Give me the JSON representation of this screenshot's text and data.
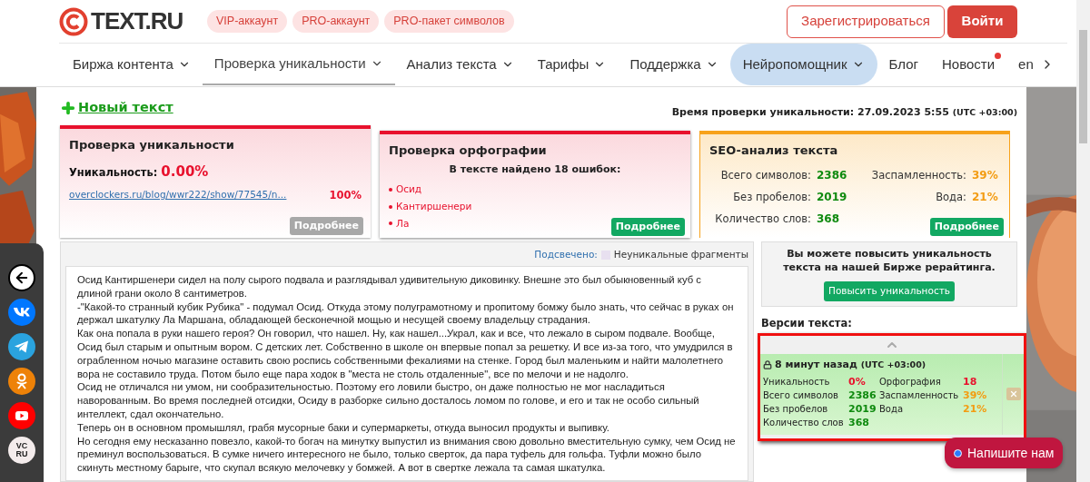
{
  "logo": {
    "text": "TEXT.RU"
  },
  "header_badges": [
    "VIP-аккаунт",
    "PRO-аккаунт",
    "PRO-пакет символов"
  ],
  "auth": {
    "register": "Зарегистрироваться",
    "login": "Войти"
  },
  "nav": [
    {
      "label": "Биржа контента",
      "dropdown": true,
      "selected": false,
      "highlighted": false,
      "notification": false
    },
    {
      "label": "Проверка уникальности",
      "dropdown": true,
      "selected": true,
      "highlighted": false,
      "notification": false
    },
    {
      "label": "Анализ текста",
      "dropdown": true,
      "selected": false,
      "highlighted": false,
      "notification": false
    },
    {
      "label": "Тарифы",
      "dropdown": true,
      "selected": false,
      "highlighted": false,
      "notification": false
    },
    {
      "label": "Поддержка",
      "dropdown": true,
      "selected": false,
      "highlighted": false,
      "notification": false
    },
    {
      "label": "Нейропомощник",
      "dropdown": true,
      "selected": false,
      "highlighted": true,
      "notification": false
    },
    {
      "label": "Блог",
      "dropdown": false,
      "selected": false,
      "highlighted": false,
      "notification": false
    },
    {
      "label": "Новости",
      "dropdown": false,
      "selected": false,
      "highlighted": false,
      "notification": true
    },
    {
      "label": "en",
      "dropdown": false,
      "selected": false,
      "highlighted": false,
      "notification": false
    }
  ],
  "new_text_link": "Новый текст",
  "check_time": {
    "label": "Время проверки уникальности:",
    "value": "27.09.2023 5:55",
    "timezone": "(UTC +03:00)"
  },
  "uniqueness_card": {
    "title": "Проверка уникальности",
    "label": "Уникальность:",
    "value": "0.00%",
    "sources": [
      {
        "url": "overclockers.ru/blog/wwr222/show/77545/n...",
        "percent": "100%"
      }
    ],
    "button": {
      "label": "Подробнее",
      "disabled": true
    }
  },
  "spelling_card": {
    "title": "Проверка орфографии",
    "summary": "В тексте найдено 18 ошибок:",
    "errors": [
      "Осид",
      "Кантиршенери",
      "Ла"
    ],
    "button": {
      "label": "Подробнее",
      "disabled": false
    }
  },
  "seo_card": {
    "title": "SEO-анализ текста",
    "stats_left": [
      {
        "label": "Всего символов:",
        "value": "2386",
        "color": "#0f8a0f"
      },
      {
        "label": "Без пробелов:",
        "value": "2019",
        "color": "#0f8a0f"
      },
      {
        "label": "Количество слов:",
        "value": "368",
        "color": "#0f8a0f"
      }
    ],
    "stats_right": [
      {
        "label": "Заспамленность:",
        "value": "39%",
        "color": "#f39c12"
      },
      {
        "label": "Вода:",
        "value": "21%",
        "color": "#f39c12"
      }
    ],
    "button": {
      "label": "Подробнее",
      "disabled": false
    }
  },
  "legend": {
    "label": "Подсвечено:",
    "swatch_label": "Неуникальные фрагменты"
  },
  "text_paragraphs": [
    "Осид Кантиршенери сидел на полу сырого подвала и разглядывал удивительную диковинку. Внешне это был обыкновенный куб с длиной грани около 8 сантиметров.",
    "-\"Какой-то странный кубик Рубика\" - подумал Осид. Откуда этому полуграмотному и пропитому бомжу было знать, что сейчас в руках он держал шкатулку Ла Маршана, обладающей бесконечной мощью и несущей своему владельцу страдания.",
    "Как она попала в руки нашего героя? Он говорил, что нашел. Ну, как нашел...Украл, как и все, что лежало в сыром подвале. Вообще, Осид был старым и опытным вором. С детских лет. Собственно в школе он впервые попал за решетку. И все из-за того, что умудрился в ограбленном ночью магазине оставить свою роспись собственными фекалиями на стенке. Город был маленьким и найти малолетнего вора не составило труда. Потом было еще пара ходок в \"места не столь отдаленные\", все по мелочи и не надолго.",
    "Осид не отличался ни умом, ни сообразительностью. Поэтому его ловили быстро, он даже полностью не мог насладиться наворованным. Во время последней отсидки, Осиду в разборке сильно досталось ломом по голове, и его и так не особо сильный интеллект, сдал окончательно.",
    "Теперь он в основном промышлял, грабя мусорные баки и супермаркеты, откуда выносил продукты и выпивку.",
    "Но сегодня ему несказанно повезло, какой-то богач на минутку выпустил из внимания свою довольно вместительную сумку, чем Осид не преминул воспользоваться. В сумке ничего интересного не было, только сверток, да пара туфель для гольфа. Туфли можно было скинуть местному барыге, что скупал всякую мелочевку у бомжей. А вот в свертке лежала та самая шкатулка."
  ],
  "promo": {
    "text": "Вы можете повысить уникальность текста на нашей Бирже рерайтинга.",
    "button": "Повысить уникальность"
  },
  "versions": {
    "title": "Версии текста:",
    "items": [
      {
        "time": "8 минут назад",
        "timezone": "(UTC +03:00)",
        "locked": true,
        "stats_left": [
          {
            "label": "Уникальность",
            "value": "0%",
            "color": "#e8112d"
          },
          {
            "label": "Всего символов",
            "value": "2386",
            "color": "#0f8a0f"
          },
          {
            "label": "Без пробелов",
            "value": "2019",
            "color": "#0f8a0f"
          },
          {
            "label": "Количество слов",
            "value": "368",
            "color": "#0f8a0f"
          }
        ],
        "stats_right": [
          {
            "label": "Орфография",
            "value": "18",
            "color": "#e8112d"
          },
          {
            "label": "Заспамленность",
            "value": "39%",
            "color": "#f39c12"
          },
          {
            "label": "Вода",
            "value": "21%",
            "color": "#f39c12"
          }
        ]
      }
    ]
  },
  "social": [
    {
      "kind": "back"
    },
    {
      "kind": "vk"
    },
    {
      "kind": "telegram"
    },
    {
      "kind": "ok"
    },
    {
      "kind": "youtube"
    },
    {
      "kind": "vc",
      "label_top": "VC",
      "label_bottom": "RU"
    }
  ],
  "chat_button": {
    "label": "Напишите нам"
  }
}
